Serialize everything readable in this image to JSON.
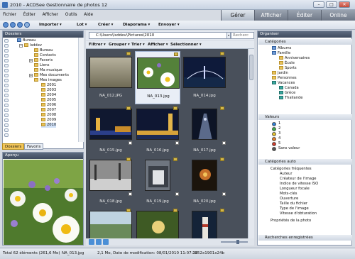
{
  "window": {
    "title": "2010 - ACDSee Gestionnaire de photos 12"
  },
  "menu": [
    "Fichier",
    "Éditer",
    "Afficher",
    "Outils",
    "Aide"
  ],
  "modes": {
    "gerer": "Gérer",
    "afficher": "Afficher",
    "editer": "Éditer",
    "online": "Online",
    "active": "Gérer"
  },
  "toolbar": {
    "importer": "Importer",
    "lot": "Lot",
    "creer": "Créer",
    "diaporama": "Diaporama",
    "envoyer": "Envoyer"
  },
  "folders": {
    "title": "Dossiers",
    "items": [
      "Bureau",
      "lsddev",
      "Bureau",
      "Contacts",
      "Favoris",
      "Liens",
      "Ma musique",
      "Mes documents",
      "Mes images",
      "2001",
      "2003",
      "2004",
      "2005",
      "2006",
      "2007",
      "2008",
      "2009",
      "2010"
    ],
    "tabs": [
      "Dossiers",
      "Favoris"
    ]
  },
  "preview": {
    "title": "Aperçu"
  },
  "path": {
    "value": "C:\\Users\\lsddev\\Pictures\\2010",
    "search_placeholder": "Recherc"
  },
  "filterbar": {
    "filtrer": "Filtrer",
    "grouper": "Grouper",
    "trier": "Trier",
    "afficher": "Afficher",
    "selectionner": "Sélectionner"
  },
  "files": [
    {
      "name": "NA_012.JPG"
    },
    {
      "name": "NA_013.jpg",
      "selected": true
    },
    {
      "name": "NA_014.jpg"
    },
    {
      "name": "NA_015.jpg"
    },
    {
      "name": "NA_016.jpg"
    },
    {
      "name": "NA_017.jpg"
    },
    {
      "name": "NA_018.jpg"
    },
    {
      "name": "NA_019.jpg"
    },
    {
      "name": "NA_020.jpg"
    },
    {
      "name": ""
    },
    {
      "name": ""
    },
    {
      "name": ""
    }
  ],
  "organizer": {
    "title": "Organiser",
    "categories_header": "Catégories",
    "categories": [
      "Albums",
      "Famille",
      "Anniversaires",
      "École",
      "Sports",
      "Jardin",
      "Personnes",
      "Vacances",
      "Canada",
      "Grèce",
      "Thaïlande"
    ],
    "ratings_header": "Valeurs",
    "ratings": [
      "1",
      "2",
      "3",
      "4",
      "5",
      "Sans valeur"
    ],
    "auto_header": "Catégories auto",
    "auto_items": [
      "Catégories fréquentes",
      "Auteur",
      "Créateur de l'image",
      "Indice de vitesse ISO",
      "Longueur focale",
      "Mots-clés",
      "Ouverture",
      "Taille du fichier",
      "Type de l'image",
      "Vitesse d'obturation",
      "Propriétés de la photo"
    ],
    "saved_header": "Recherches enregistrées"
  },
  "status": {
    "total": "Total 62 éléments  (261,6 Mo)",
    "file": "NA_013.jpg",
    "info": "2,1 Mo, Date de modification: 08/01/2010 11:07:12",
    "dims": "2852x1901x24b"
  },
  "colors": {
    "accent": "#3f4b5e",
    "grid_bg": "#49505b",
    "folder": "#e8c35a"
  }
}
